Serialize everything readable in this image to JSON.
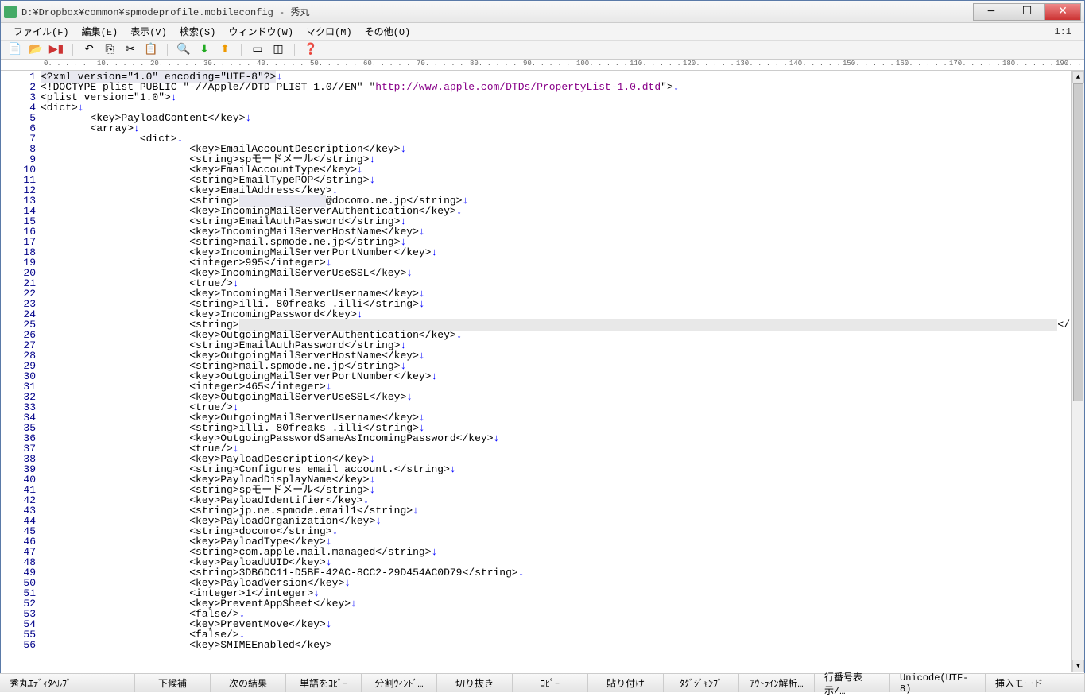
{
  "title": "D:¥Dropbox¥common¥spmodeprofile.mobileconfig  - 秀丸",
  "menus": {
    "file": "ファイル(F)",
    "edit": "編集(E)",
    "view": "表示(V)",
    "search": "検索(S)",
    "window": "ウィンドウ(W)",
    "macro": "マクロ(M)",
    "other": "その他(O)"
  },
  "cursor": "1:1",
  "ruler_marks": [
    "0",
    "10",
    "20",
    "30",
    "40",
    "50",
    "60",
    "70",
    "80",
    "90",
    "100",
    "110",
    "120",
    "130",
    "140",
    "150",
    "160",
    "170",
    "180",
    "190"
  ],
  "lines": [
    {
      "n": 1,
      "t": "<?xml version=\"1.0\" encoding=\"UTF-8\"?>",
      "hl": true
    },
    {
      "n": 2,
      "pre": "<!DOCTYPE plist PUBLIC \"-//Apple//DTD PLIST 1.0//EN\" \"",
      "url": "http://www.apple.com/DTDs/PropertyList-1.0.dtd",
      "post": "\">"
    },
    {
      "n": 3,
      "t": "<plist version=\"1.0\">"
    },
    {
      "n": 4,
      "t": "<dict>"
    },
    {
      "n": 5,
      "t": "        <key>PayloadContent</key>"
    },
    {
      "n": 6,
      "t": "        <array>"
    },
    {
      "n": 7,
      "t": "                <dict>"
    },
    {
      "n": 8,
      "t": "                        <key>EmailAccountDescription</key>"
    },
    {
      "n": 9,
      "t": "                        <string>spモードメール</string>"
    },
    {
      "n": 10,
      "t": "                        <key>EmailAccountType</key>"
    },
    {
      "n": 11,
      "t": "                        <string>EmailTypePOP</string>"
    },
    {
      "n": 12,
      "t": "                        <key>EmailAddress</key>"
    },
    {
      "n": 13,
      "pre": "                        <string>",
      "hl_mid": "              ",
      "mid": "@docomo.ne.jp",
      "post": "</string>"
    },
    {
      "n": 14,
      "t": "                        <key>IncomingMailServerAuthentication</key>"
    },
    {
      "n": 15,
      "t": "                        <string>EmailAuthPassword</string>"
    },
    {
      "n": 16,
      "t": "                        <key>IncomingMailServerHostName</key>"
    },
    {
      "n": 17,
      "t": "                        <string>mail.spmode.ne.jp</string>"
    },
    {
      "n": 18,
      "t": "                        <key>IncomingMailServerPortNumber</key>"
    },
    {
      "n": 19,
      "t": "                        <integer>995</integer>"
    },
    {
      "n": 20,
      "t": "                        <key>IncomingMailServerUseSSL</key>"
    },
    {
      "n": 21,
      "t": "                        <true/>"
    },
    {
      "n": 22,
      "t": "                        <key>IncomingMailServerUsername</key>"
    },
    {
      "n": 23,
      "t": "                        <string>illi._80freaks_.illi</string>"
    },
    {
      "n": 24,
      "t": "                        <key>IncomingPassword</key>"
    },
    {
      "n": 25,
      "pre": "                        <string>",
      "redact": "                                                                                                                                    ",
      "post": "</string>"
    },
    {
      "n": 26,
      "t": "                        <key>OutgoingMailServerAuthentication</key>"
    },
    {
      "n": 27,
      "t": "                        <string>EmailAuthPassword</string>"
    },
    {
      "n": 28,
      "t": "                        <key>OutgoingMailServerHostName</key>"
    },
    {
      "n": 29,
      "t": "                        <string>mail.spmode.ne.jp</string>"
    },
    {
      "n": 30,
      "t": "                        <key>OutgoingMailServerPortNumber</key>"
    },
    {
      "n": 31,
      "t": "                        <integer>465</integer>"
    },
    {
      "n": 32,
      "t": "                        <key>OutgoingMailServerUseSSL</key>"
    },
    {
      "n": 33,
      "t": "                        <true/>"
    },
    {
      "n": 34,
      "t": "                        <key>OutgoingMailServerUsername</key>"
    },
    {
      "n": 35,
      "t": "                        <string>illi._80freaks_.illi</string>"
    },
    {
      "n": 36,
      "t": "                        <key>OutgoingPasswordSameAsIncomingPassword</key>"
    },
    {
      "n": 37,
      "t": "                        <true/>"
    },
    {
      "n": 38,
      "t": "                        <key>PayloadDescription</key>"
    },
    {
      "n": 39,
      "t": "                        <string>Configures email account.</string>"
    },
    {
      "n": 40,
      "t": "                        <key>PayloadDisplayName</key>"
    },
    {
      "n": 41,
      "t": "                        <string>spモードメール</string>"
    },
    {
      "n": 42,
      "t": "                        <key>PayloadIdentifier</key>"
    },
    {
      "n": 43,
      "t": "                        <string>jp.ne.spmode.email1</string>"
    },
    {
      "n": 44,
      "t": "                        <key>PayloadOrganization</key>"
    },
    {
      "n": 45,
      "t": "                        <string>docomo</string>"
    },
    {
      "n": 46,
      "t": "                        <key>PayloadType</key>"
    },
    {
      "n": 47,
      "t": "                        <string>com.apple.mail.managed</string>"
    },
    {
      "n": 48,
      "t": "                        <key>PayloadUUID</key>"
    },
    {
      "n": 49,
      "t": "                        <string>3DB6DC11-D5BF-42AC-8CC2-29D454AC0D79</string>"
    },
    {
      "n": 50,
      "t": "                        <key>PayloadVersion</key>"
    },
    {
      "n": 51,
      "t": "                        <integer>1</integer>"
    },
    {
      "n": 52,
      "t": "                        <key>PreventAppSheet</key>"
    },
    {
      "n": 53,
      "t": "                        <false/>"
    },
    {
      "n": 54,
      "t": "                        <key>PreventMove</key>"
    },
    {
      "n": 55,
      "t": "                        <false/>"
    },
    {
      "n": 56,
      "t": "                        <key>SMIMEEnabled</key>",
      "nonl": true
    }
  ],
  "status": {
    "help": "秀丸ｴﾃﾞｨﾀﾍﾙﾌﾟ",
    "next_cand": "下候補",
    "next_result": "次の結果",
    "copy_word": "単語をｺﾋﾟｰ",
    "split": "分割ｳｨﾝﾄﾞ…",
    "cut": "切り抜き",
    "copy": "ｺﾋﾟｰ",
    "paste": "貼り付け",
    "tag_jump": "ﾀｸﾞｼﾞｬﾝﾌﾟ",
    "outline": "ｱｳﾄﾗｲﾝ解析…",
    "line_no": "行番号表示/…",
    "encoding": "Unicode(UTF-8)",
    "mode": "挿入モード"
  }
}
